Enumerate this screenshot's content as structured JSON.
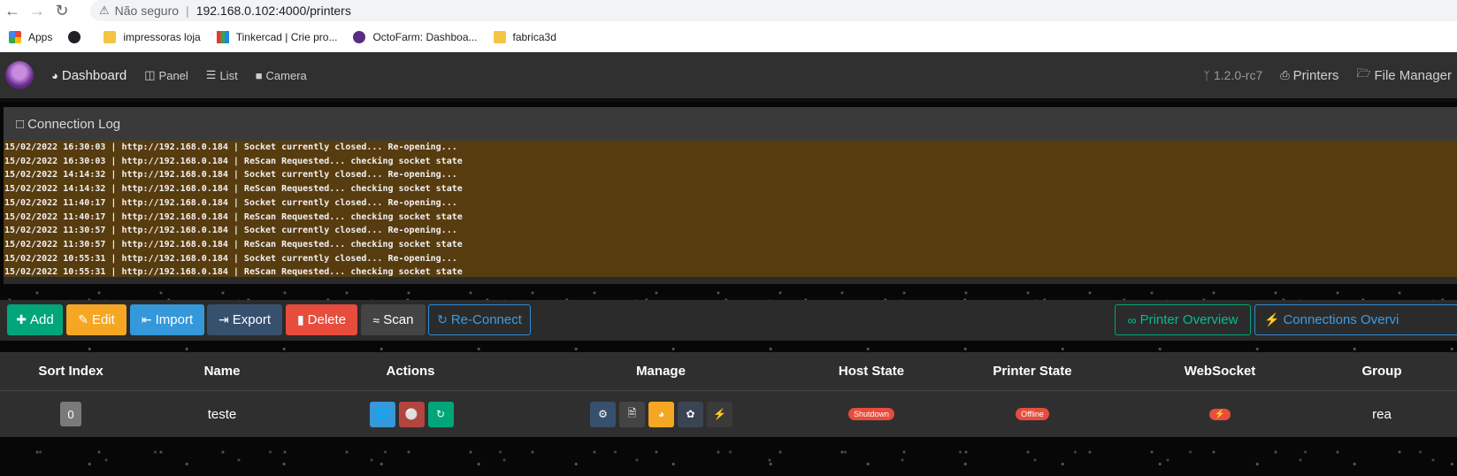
{
  "browser": {
    "security_label": "Não seguro",
    "url": "192.168.0.102:4000/printers",
    "bookmarks": [
      "Apps",
      "impressoras loja",
      "Tinkercad | Crie pro...",
      "OctoFarm: Dashboa...",
      "fabrica3d"
    ]
  },
  "navbar": {
    "dashboard": "Dashboard",
    "panel": "Panel",
    "list": "List",
    "camera": "Camera",
    "version": "1.2.0-rc7",
    "printers": "Printers",
    "file_manager": "File Manager"
  },
  "connection_log": {
    "title": "Connection Log",
    "lines": [
      "15/02/2022 16:30:03 | http://192.168.0.184 | Socket currently closed... Re-opening...",
      "15/02/2022 16:30:03 | http://192.168.0.184 | ReScan Requested... checking socket state",
      "15/02/2022 14:14:32 | http://192.168.0.184 | Socket currently closed... Re-opening...",
      "15/02/2022 14:14:32 | http://192.168.0.184 | ReScan Requested... checking socket state",
      "15/02/2022 11:40:17 | http://192.168.0.184 | Socket currently closed... Re-opening...",
      "15/02/2022 11:40:17 | http://192.168.0.184 | ReScan Requested... checking socket state",
      "15/02/2022 11:30:57 | http://192.168.0.184 | Socket currently closed... Re-opening...",
      "15/02/2022 11:30:57 | http://192.168.0.184 | ReScan Requested... checking socket state",
      "15/02/2022 10:55:31 | http://192.168.0.184 | Socket currently closed... Re-opening...",
      "15/02/2022 10:55:31 | http://192.168.0.184 | ReScan Requested... checking socket state"
    ]
  },
  "toolbar": {
    "add": "Add",
    "edit": "Edit",
    "import": "Import",
    "export": "Export",
    "delete": "Delete",
    "scan": "Scan",
    "reconnect": "Re-Connect",
    "printer_overview": "Printer Overview",
    "connections_overview": "Connections Overvi"
  },
  "table": {
    "headers": [
      "Sort Index",
      "Name",
      "Actions",
      "Manage",
      "Host State",
      "Printer State",
      "WebSocket",
      "Group"
    ],
    "rows": [
      {
        "sort_index": "0",
        "name": "teste",
        "host_state": "Shutdown",
        "printer_state": "Offline",
        "group": "rea"
      }
    ]
  },
  "colors": {
    "log_bg": "#573c10",
    "add": "#00a67a",
    "edit": "#f5a623",
    "import": "#3498db",
    "export": "#37506e",
    "delete": "#e74c3c",
    "scan": "#444444",
    "reconnect": "#3a9ee6",
    "overview": "#00c08d",
    "status_red": "#e74c3c"
  }
}
